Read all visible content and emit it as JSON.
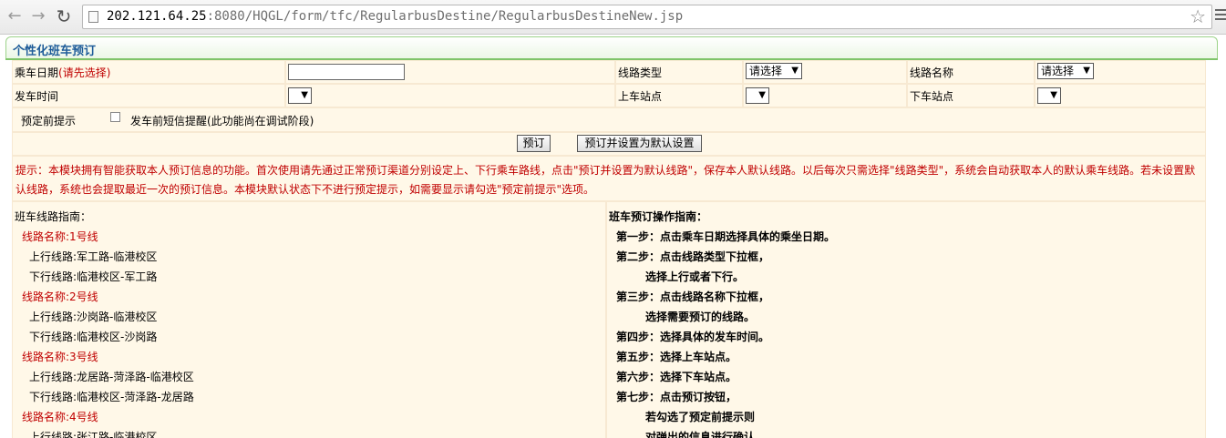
{
  "browser": {
    "url_host": "202.121.64.25",
    "url_path": ":8080/HQGL/form/tfc/RegularbusDestine/RegularbusDestineNew.jsp"
  },
  "page": {
    "title": "个性化班车预订"
  },
  "form": {
    "date_label": "乘车日期",
    "date_hint": "(请先选择)",
    "date_value": "",
    "route_type_label": "线路类型",
    "route_type_value": "请选择",
    "route_name_label": "线路名称",
    "route_name_value": "请选择",
    "depart_time_label": "发车时间",
    "depart_time_value": "",
    "board_stop_label": "上车站点",
    "board_stop_value": "",
    "alight_stop_label": "下车站点",
    "alight_stop_value": "",
    "pre_tip_label": "预定前提示",
    "sms_label": "发车前短信提醒(此功能尚在调试阶段)",
    "book_button": "预订",
    "book_default_button": "预订并设置为默认设置",
    "tip_text": "提示：本模块拥有智能获取本人预订信息的功能。首次使用请先通过正常预订渠道分别设定上、下行乘车路线，点击\"预订并设置为默认线路\"，保存本人默认线路。以后每次只需选择\"线路类型\"，系统会自动获取本人的默认乘车线路。若未设置默认线路，系统也会提取最近一次的预订信息。本模块默认状态下不进行预定提示，如需要显示请勾选\"预定前提示\"选项。"
  },
  "routes_guide": {
    "heading": "班车线路指南：",
    "routes": [
      {
        "name": "线路名称:1号线",
        "up": "上行线路:军工路-临港校区",
        "down": "下行线路:临港校区-军工路"
      },
      {
        "name": "线路名称:2号线",
        "up": "上行线路:沙岗路-临港校区",
        "down": "下行线路:临港校区-沙岗路"
      },
      {
        "name": "线路名称:3号线",
        "up": "上行线路:龙居路-菏泽路-临港校区",
        "down": "下行线路:临港校区-菏泽路-龙居路"
      },
      {
        "name": "线路名称:4号线",
        "up": "上行线路:张江路-临港校区",
        "down": ""
      }
    ]
  },
  "ops_guide": {
    "heading": "班车预订操作指南：",
    "steps": [
      "第一步：点击乘车日期选择具体的乘坐日期。",
      "第二步：点击线路类型下拉框，",
      "选择上行或者下行。",
      "第三步：点击线路名称下拉框，",
      "选择需要预订的线路。",
      "第四步：选择具体的发车时间。",
      "第五步：选择上车站点。",
      "第六步：选择下车站点。",
      "第七步：点击预订按钮，",
      "若勾选了预定前提示则",
      "对弹出的信息进行确认。"
    ]
  }
}
